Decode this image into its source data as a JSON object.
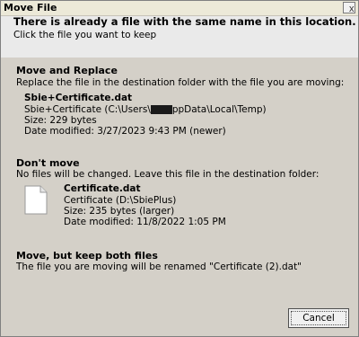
{
  "window": {
    "title": "Move File",
    "close_glyph": "x"
  },
  "header": {
    "heading": "There is already a file with the same name in this location.",
    "subheading": "Click the file you want to keep"
  },
  "move_replace": {
    "title": "Move and Replace",
    "description": "Replace the file in the destination folder with the file you are moving:",
    "file_name": "Sbie+Certificate.dat",
    "path_prefix": "Sbie+Certificate (C:\\Users\\",
    "path_suffix": "ppData\\Local\\Temp)",
    "size": "Size: 229 bytes",
    "date": "Date modified: 3/27/2023 9:43 PM (newer)"
  },
  "dont_move": {
    "title": "Don't move",
    "description": "No files will be changed. Leave this file in the destination folder:",
    "file_name": "Certificate.dat",
    "path": "Certificate (D:\\SbiePlus)",
    "size": "Size: 235 bytes (larger)",
    "date": "Date modified: 11/8/2022 1:05 PM"
  },
  "keep_both": {
    "title": "Move, but keep both files",
    "description": "The file you are moving will be renamed \"Certificate (2).dat\""
  },
  "buttons": {
    "cancel": "Cancel"
  },
  "colors": {
    "dialog_bg": "#d4d0c8",
    "header_bg": "#eaeaea",
    "text": "#000000"
  },
  "icons": {
    "file": "document-file-icon",
    "close": "close-icon"
  }
}
